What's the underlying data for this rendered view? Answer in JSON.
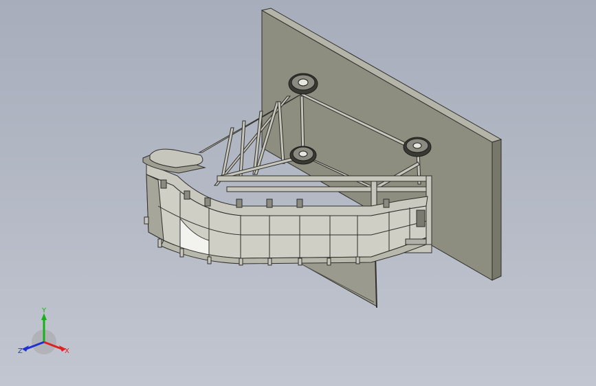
{
  "viewport": {
    "background_top": "#a7adbb",
    "background_bottom": "#c2c6d0"
  },
  "model": {
    "colors": {
      "wall_face": "#8e8e80",
      "wall_side": "#77776a",
      "wall_top": "#b4b4a8",
      "steel": "#c6c6bc",
      "steel_dark": "#6f6f64",
      "edge": "#2e2e2a",
      "panel": "#cfcfc5",
      "panel_light": "#f2f2ee",
      "panel_shadow": "#a6a69b",
      "hopper": "#9a9a8e"
    },
    "components": [
      "wall-plate",
      "hopper-plate",
      "truss-frame",
      "curved-panel-wall",
      "pipe-supports",
      "pulleys",
      "top-cover"
    ]
  },
  "triad": {
    "labels": {
      "x": "X",
      "y": "Y",
      "z": "Z"
    },
    "colors": {
      "x": "#e02020",
      "y": "#18b018",
      "z": "#2030d0"
    }
  }
}
